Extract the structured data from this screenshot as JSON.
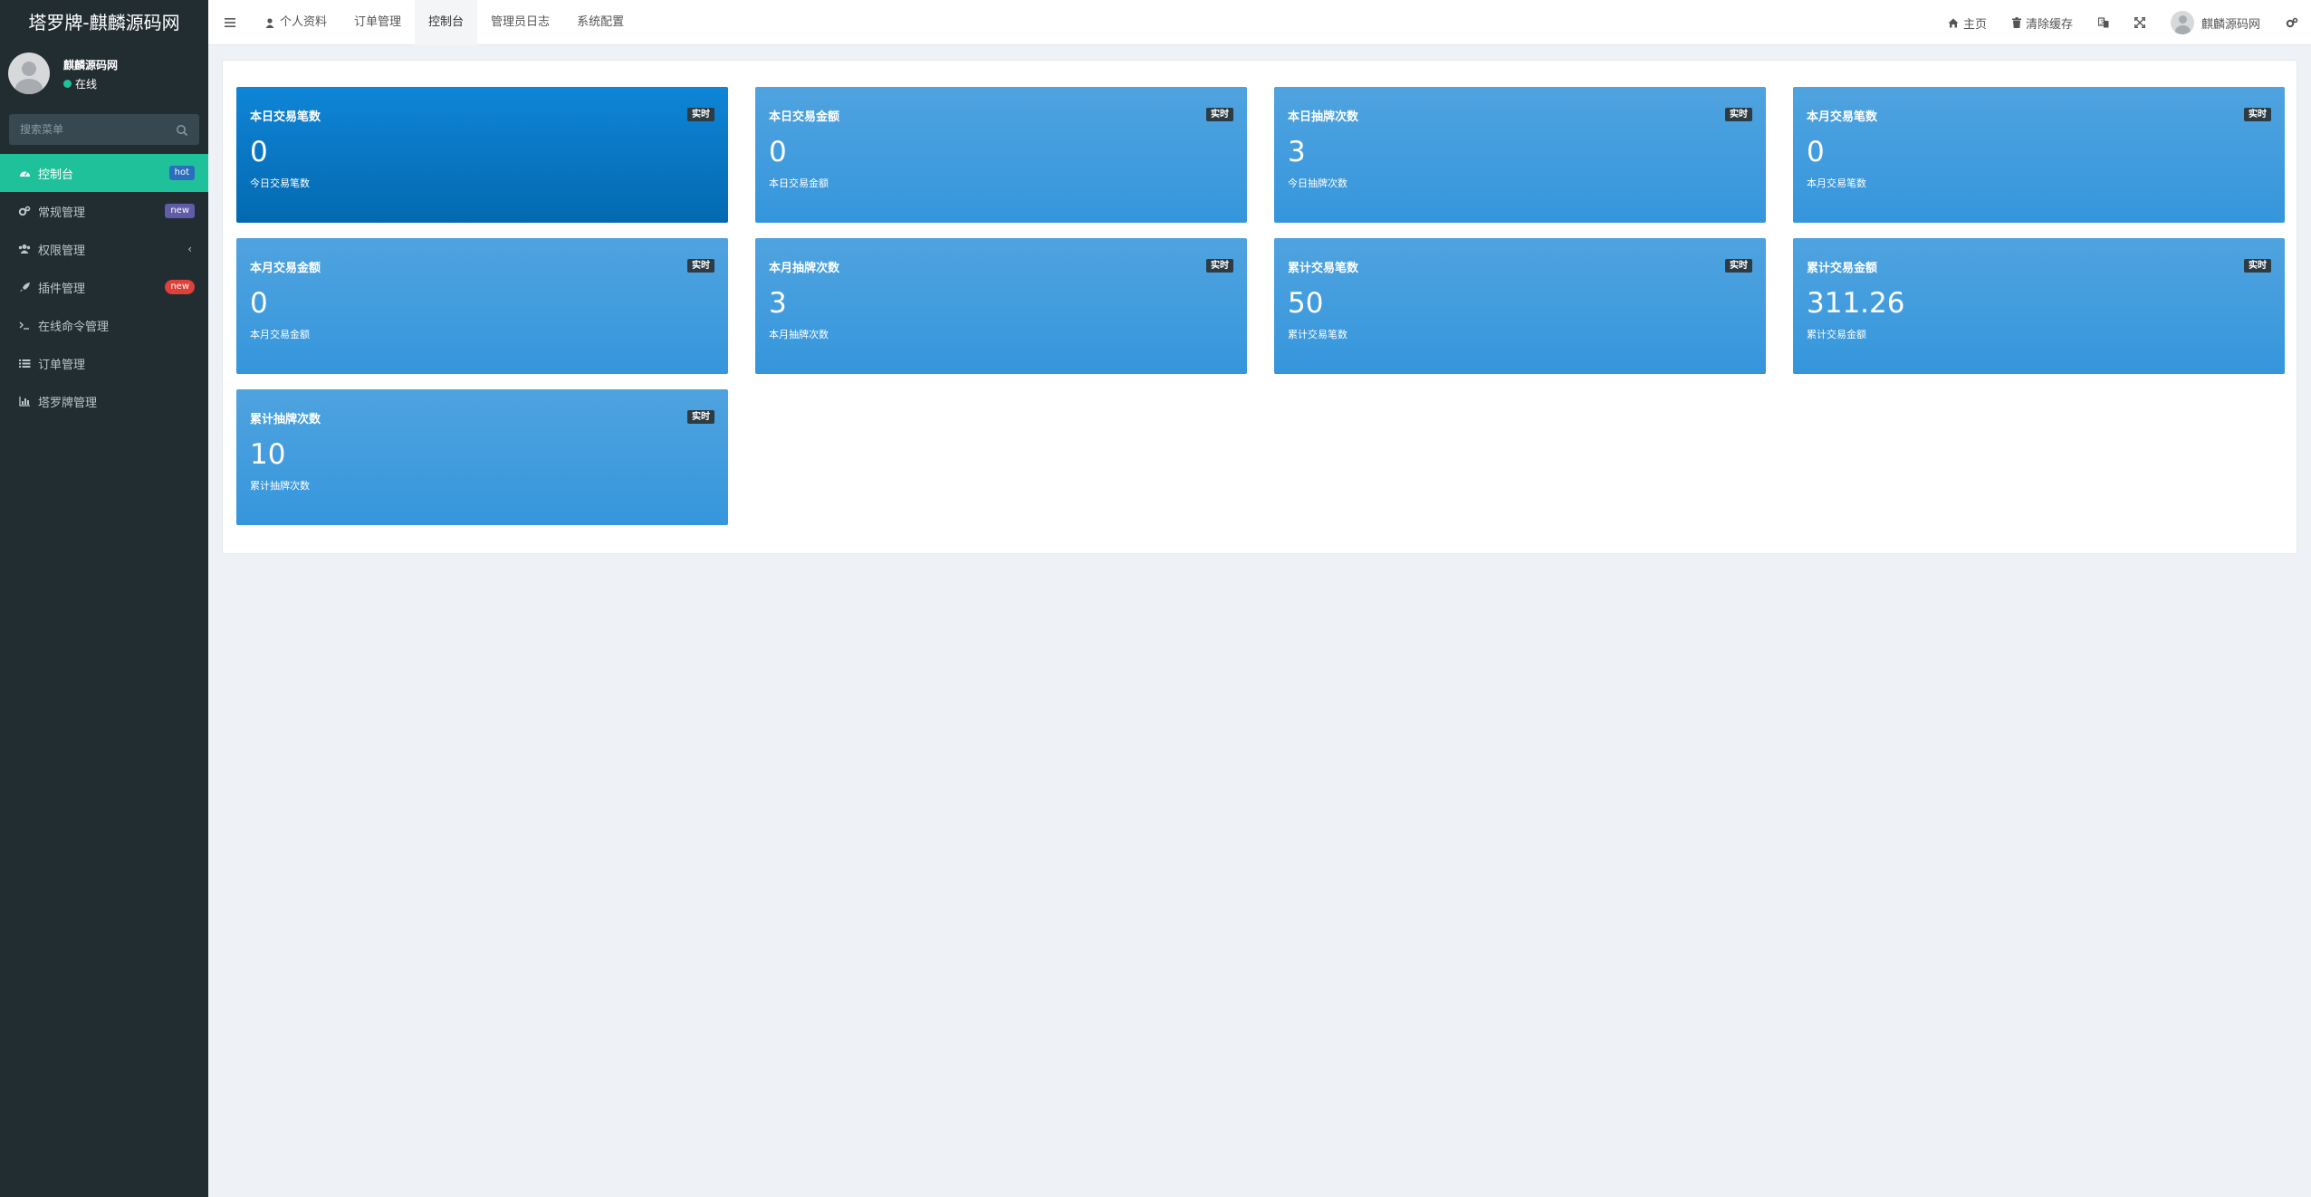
{
  "app": {
    "title": "塔罗牌-麒麟源码网"
  },
  "user": {
    "name": "麒麟源码网",
    "status": "在线"
  },
  "search": {
    "placeholder": "搜索菜单"
  },
  "sidebar": {
    "items": [
      {
        "label": "控制台",
        "icon": "dashboard-icon",
        "badge": "hot"
      },
      {
        "label": "常规管理",
        "icon": "cogs-icon",
        "badge": "new"
      },
      {
        "label": "权限管理",
        "icon": "group-icon",
        "chevron": "‹"
      },
      {
        "label": "插件管理",
        "icon": "rocket-icon",
        "badge": "new"
      },
      {
        "label": "在线命令管理",
        "icon": "terminal-icon"
      },
      {
        "label": "订单管理",
        "icon": "list-icon"
      },
      {
        "label": "塔罗牌管理",
        "icon": "chart-icon"
      }
    ]
  },
  "topnav": {
    "tabs": [
      "个人资料",
      "订单管理",
      "控制台",
      "管理员日志",
      "系统配置"
    ],
    "home": "主页",
    "clear_cache": "清除缓存",
    "username": "麒麟源码网"
  },
  "cards": [
    {
      "title": "本日交易笔数",
      "tag": "实时",
      "value": "0",
      "sub": "今日交易笔数"
    },
    {
      "title": "本日交易金额",
      "tag": "实时",
      "value": "0",
      "sub": "本日交易金额"
    },
    {
      "title": "本日抽牌次数",
      "tag": "实时",
      "value": "3",
      "sub": "今日抽牌次数"
    },
    {
      "title": "本月交易笔数",
      "tag": "实时",
      "value": "0",
      "sub": "本月交易笔数"
    },
    {
      "title": "本月交易金额",
      "tag": "实时",
      "value": "0",
      "sub": "本月交易金额"
    },
    {
      "title": "本月抽牌次数",
      "tag": "实时",
      "value": "3",
      "sub": "本月抽牌次数"
    },
    {
      "title": "累计交易笔数",
      "tag": "实时",
      "value": "50",
      "sub": "累计交易笔数"
    },
    {
      "title": "累计交易金额",
      "tag": "实时",
      "value": "311.26",
      "sub": "累计交易金额"
    },
    {
      "title": "累计抽牌次数",
      "tag": "实时",
      "value": "10",
      "sub": "累计抽牌次数"
    }
  ],
  "colors": {
    "sidebar_bg": "#222d32",
    "active": "#1fc19b",
    "card": "#3c9be0",
    "card_dark": "#0a77c4"
  }
}
